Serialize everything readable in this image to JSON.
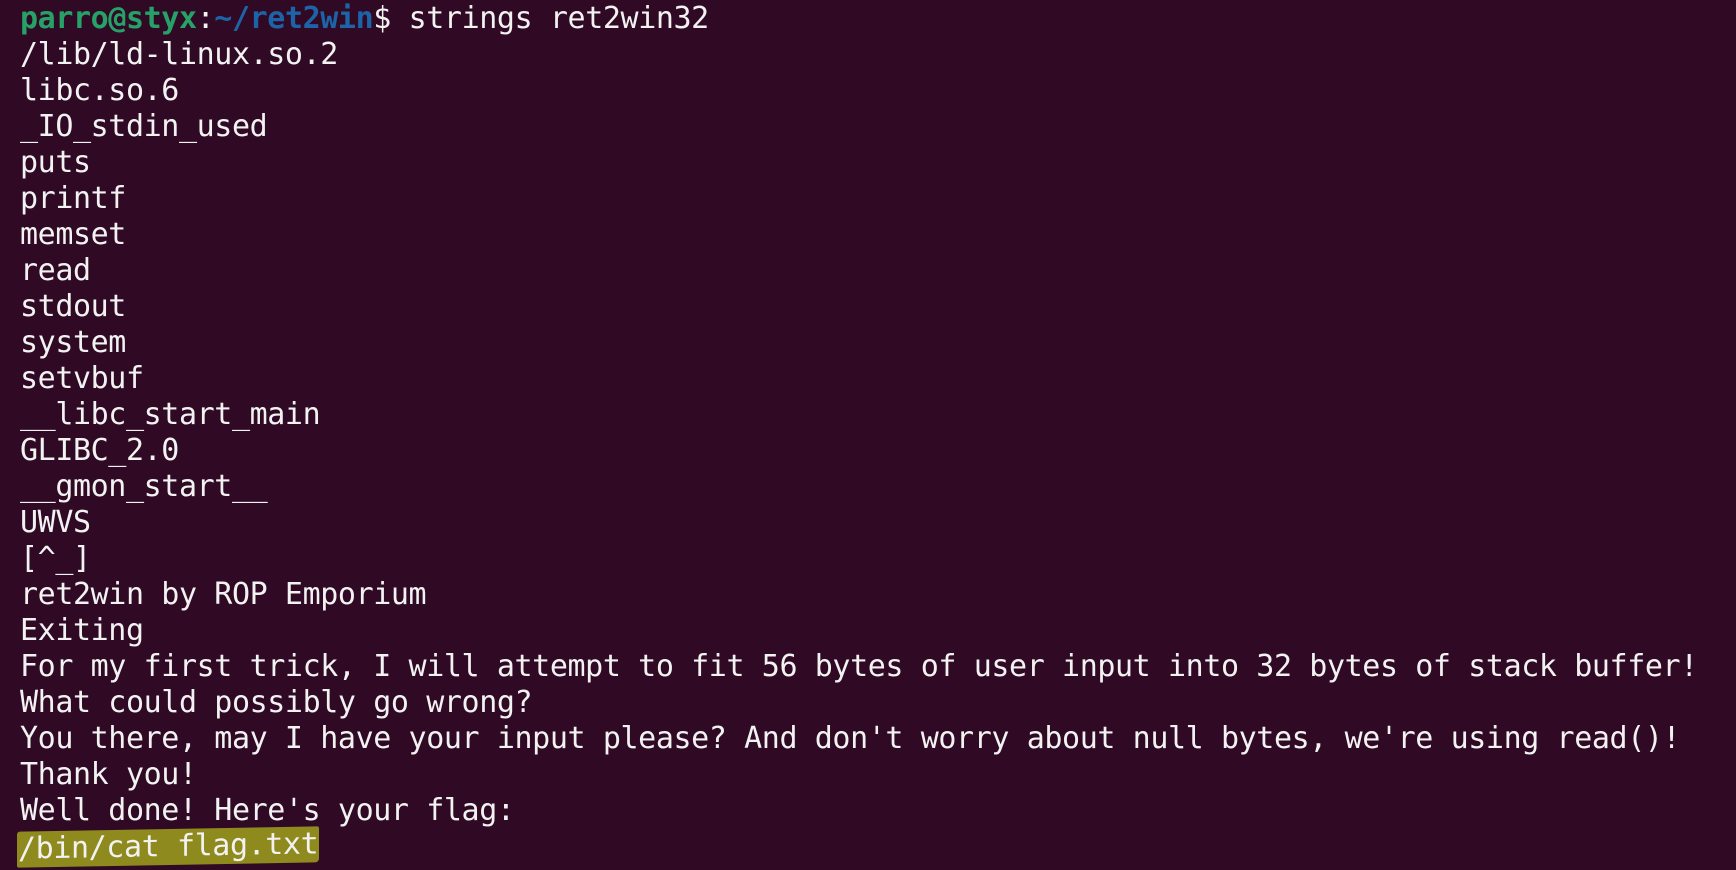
{
  "colors": {
    "background": "#300a24",
    "text": "#f2f2f2",
    "prompt_user": "#26a269",
    "prompt_path": "#1d63a8",
    "highlight": "#8f8a1e"
  },
  "prompt": {
    "user_host": "parro@styx",
    "colon": ":",
    "path": "~/ret2win",
    "dollar": "$",
    "command": " strings ret2win32"
  },
  "output": [
    "/lib/ld-linux.so.2",
    "libc.so.6",
    "_IO_stdin_used",
    "puts",
    "printf",
    "memset",
    "read",
    "stdout",
    "system",
    "setvbuf",
    "__libc_start_main",
    "GLIBC_2.0",
    "__gmon_start__",
    "UWVS",
    "[^_]",
    "ret2win by ROP Emporium",
    "Exiting",
    "For my first trick, I will attempt to fit 56 bytes of user input into 32 bytes of stack buffer!",
    "What could possibly go wrong?",
    "You there, may I have your input please? And don't worry about null bytes, we're using read()!",
    "Thank you!",
    "Well done! Here's your flag:"
  ],
  "highlighted_line": "/bin/cat flag.txt"
}
